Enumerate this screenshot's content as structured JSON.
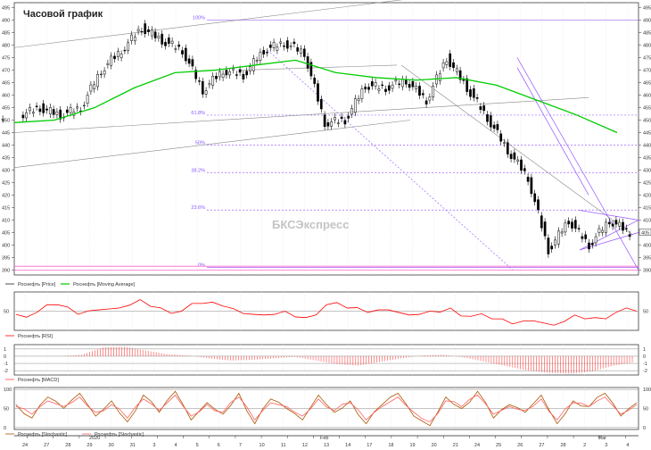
{
  "chart_data": [
    {
      "type": "line",
      "title": "Часовой график",
      "subtype": "candlestick with moving average",
      "series": [
        {
          "name": "Роснефть [Price]",
          "color": "#000000",
          "x": [
            "2020-01-24",
            "2020-01-25",
            "2020-01-27",
            "2020-01-28",
            "2020-01-29",
            "2020-01-30",
            "2020-01-31",
            "2020-02-03",
            "2020-02-04",
            "2020-02-05",
            "2020-02-06",
            "2020-02-07",
            "2020-02-08",
            "2020-02-10",
            "2020-02-11",
            "2020-02-12",
            "2020-02-13",
            "2020-02-14",
            "2020-02-17",
            "2020-02-18",
            "2020-02-19",
            "2020-02-20",
            "2020-02-21",
            "2020-02-24",
            "2020-02-25",
            "2020-02-26",
            "2020-02-27",
            "2020-02-28",
            "2020-03-02",
            "2020-03-03",
            "2020-03-04"
          ],
          "values": [
            452,
            455,
            452,
            455,
            470,
            478,
            487,
            482,
            478,
            462,
            470,
            468,
            478,
            481,
            477,
            449,
            450,
            464,
            463,
            466,
            458,
            475,
            463,
            451,
            438,
            427,
            398,
            410,
            400,
            410,
            405
          ]
        },
        {
          "name": "Роснефть [Moving Average]",
          "color": "#00cc00",
          "x": [
            "2020-01-24",
            "2020-01-27",
            "2020-01-29",
            "2020-01-31",
            "2020-02-04",
            "2020-02-06",
            "2020-02-08",
            "2020-02-11",
            "2020-02-13",
            "2020-02-17",
            "2020-02-19",
            "2020-02-21",
            "2020-02-25",
            "2020-02-27",
            "2020-03-02",
            "2020-03-04"
          ],
          "values": [
            449,
            450,
            455,
            463,
            469,
            470,
            472,
            474,
            469,
            467,
            466,
            467,
            464,
            458,
            452,
            445
          ]
        }
      ],
      "y_ticks": [
        390,
        395,
        400,
        405,
        410,
        415,
        420,
        425,
        430,
        435,
        440,
        445,
        450,
        455,
        460,
        465,
        470,
        475,
        480,
        485,
        490,
        495
      ],
      "ylim": [
        388,
        497
      ],
      "last_price_label": "405",
      "fib_levels": [
        {
          "label": "100%",
          "value": 490
        },
        {
          "label": "61.8%",
          "value": 452
        },
        {
          "label": "50%",
          "value": 440
        },
        {
          "label": "38.2%",
          "value": 429
        },
        {
          "label": "23.6%",
          "value": 414
        },
        {
          "label": "0%",
          "value": 391
        }
      ],
      "watermark": "БКСЭкспресс"
    },
    {
      "type": "line",
      "series": [
        {
          "name": "Роснефть [RSI]",
          "color": "#ff0000",
          "values": [
            45,
            48,
            60,
            45,
            52,
            55,
            68,
            55,
            50,
            62,
            58,
            46,
            44,
            50,
            40,
            60,
            55,
            48,
            52,
            44,
            50,
            55,
            42,
            38,
            30,
            35,
            28,
            44,
            40,
            48,
            50
          ]
        }
      ],
      "y_ticks": [
        50
      ],
      "ylim": [
        20,
        80
      ]
    },
    {
      "type": "bar",
      "series": [
        {
          "name": "Роснефть [MACD]",
          "color": "#ff4444",
          "values": [
            0,
            0,
            0,
            0.2,
            1.2,
            1.3,
            0.8,
            0.3,
            0.1,
            -0.3,
            -0.6,
            -0.5,
            -0.3,
            -0.1,
            -0.6,
            -1.1,
            -1.3,
            -0.8,
            -0.3,
            0.1,
            0.2,
            -0.2,
            -0.8,
            -1.4,
            -2.0,
            -2.3,
            -2.4,
            -2.1,
            -1.3,
            -0.8
          ]
        }
      ],
      "y_ticks": [
        1,
        0,
        -1,
        -2
      ],
      "ylim": [
        -2.6,
        1.6
      ]
    },
    {
      "type": "line",
      "series": [
        {
          "name": "Роснефть [Stochastic]",
          "color": "#aa5500",
          "values": [
            60,
            25,
            80,
            50,
            90,
            30,
            70,
            15,
            85,
            40,
            95,
            20,
            65,
            35,
            90,
            10,
            75,
            50,
            20,
            85,
            40,
            70,
            10,
            60,
            90,
            30,
            5,
            80,
            50,
            95,
            25,
            60,
            40,
            85,
            10,
            70,
            55,
            90,
            30,
            65
          ]
        },
        {
          "name": "Роснефть [Stochastic]",
          "color": "#ff6060",
          "values": [
            55,
            35,
            70,
            55,
            80,
            40,
            60,
            25,
            75,
            45,
            85,
            30,
            60,
            40,
            80,
            20,
            65,
            55,
            30,
            75,
            45,
            65,
            20,
            55,
            80,
            40,
            15,
            70,
            55,
            85,
            35,
            55,
            45,
            75,
            20,
            65,
            55,
            80,
            35,
            60
          ]
        }
      ],
      "y_ticks": [
        100,
        50,
        0
      ],
      "ylim": [
        -5,
        105
      ]
    }
  ],
  "x_axis": {
    "labels": [
      "24",
      "27",
      "28",
      "29",
      "30",
      "31",
      "3",
      "4",
      "5",
      "6",
      "7",
      "10",
      "11",
      "12",
      "13",
      "14",
      "17",
      "18",
      "19",
      "20",
      "21",
      "24",
      "25",
      "26",
      "27",
      "28",
      "2",
      "3",
      "4"
    ],
    "top_labels": [
      "25",
      "27",
      "3",
      "10",
      "14",
      "16",
      "20",
      "22",
      "24",
      "28",
      "30",
      "3",
      "5",
      "7",
      "10",
      "12",
      "14",
      "17",
      "19",
      "21",
      "25",
      "27",
      "2",
      "4"
    ],
    "month_labels": [
      {
        "text": "2020",
        "pos": 0.12
      },
      {
        "text": "Feb",
        "pos": 0.49
      },
      {
        "text": "Mar",
        "pos": 0.935
      }
    ]
  }
}
